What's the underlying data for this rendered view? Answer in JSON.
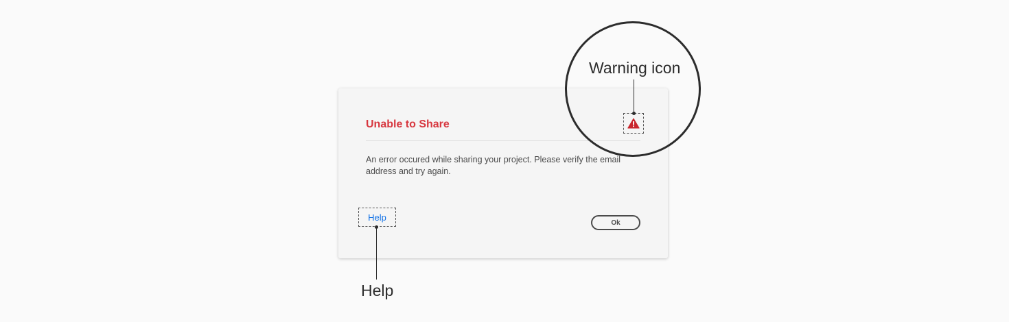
{
  "dialog": {
    "title": "Unable to Share",
    "message": "An error occured while sharing your project. Please verify the email address and try again.",
    "help_link": "Help",
    "ok_button": "Ok"
  },
  "annotations": {
    "warning_icon_label": "Warning icon",
    "help_label": "Help"
  },
  "icons": {
    "warning": "warning-icon"
  },
  "colors": {
    "background": "#fafafa",
    "dialog_background": "#f5f5f5",
    "title": "#d7373f",
    "warning_icon": "#c9252d",
    "link": "#1473e6",
    "body_text": "#4b4b4b",
    "annotation": "#2c2c2c"
  }
}
